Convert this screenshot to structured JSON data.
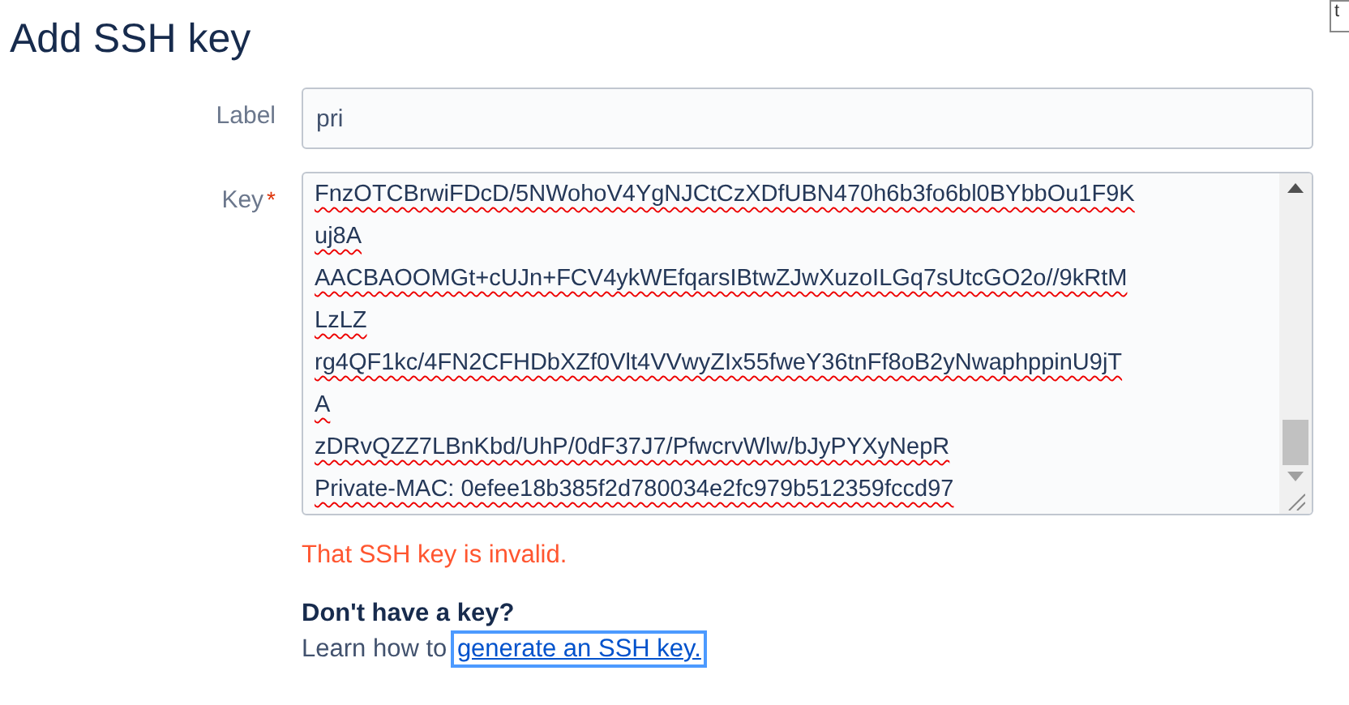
{
  "title": "Add SSH key",
  "tooltip": "t",
  "label_field": {
    "label": "Label",
    "value": "pri"
  },
  "key_field": {
    "label": "Key",
    "required_mark": "*",
    "lines": [
      "FnzOTCBrwiFDcD/5NWohoV4YgNJCtCzXDfUBN470h6b3fo6bl0BYbbOu1F9K",
      "uj8A",
      "AACBAOOMGt+cUJn+FCV4ykWEfqarsIBtwZJwXuzoILGq7sUtcGO2o//9kRtM",
      "LzLZ",
      "rg4QF1kc/4FN2CFHDbXZf0Vlt4VVwyZIx55fweY36tnFf8oB2yNwaphppinU9jT",
      "A",
      "zDRvQZZ7LBnKbd/UhP/0dF37J7/PfwcrvWlw/bJyPYXyNepR",
      "Private-MAC: 0efee18b385f2d780034e2fc979b512359fccd97"
    ]
  },
  "error": "That SSH key is invalid.",
  "help": {
    "heading": "Don't have a key?",
    "text": "Learn how to",
    "link": "generate an SSH key."
  }
}
